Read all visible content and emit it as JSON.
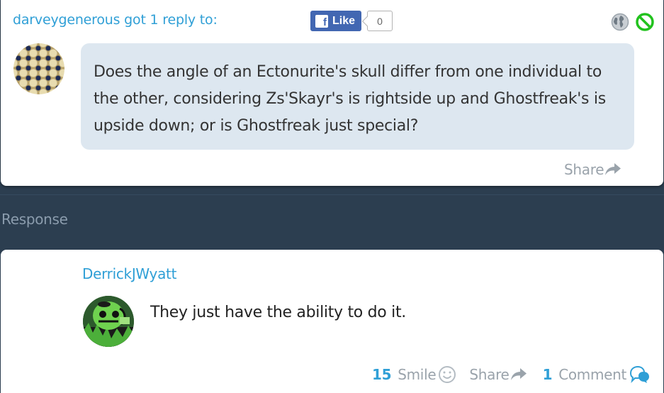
{
  "post": {
    "header": "darveygenerous got 1 reply to:",
    "fb_like_label": "Like",
    "fb_like_count": "0",
    "question": "Does the angle of an Ectonurite's skull differ from one individual to the other, considering Zs'Skayr's is rightside up and Ghostfreak's is upside down; or is Ghostfreak just special?",
    "share_label": "Share"
  },
  "section_label": "Response",
  "reply": {
    "username": "DerrickJWyatt",
    "text": "They just have the ability to do it.",
    "smile_count": "15",
    "smile_label": "Smile",
    "share_label": "Share",
    "comment_count": "1",
    "comment_label": "Comment"
  },
  "icons": {
    "globe": "globe-icon",
    "block": "block-icon",
    "share": "share-arrow-icon",
    "smile": "smile-icon",
    "comment": "comment-bubble-icon"
  },
  "colors": {
    "background": "#2c3e50",
    "accent": "#2f9fd6",
    "bubble": "#dde7f0",
    "facebook": "#4267b2",
    "block_green": "#22c21e"
  }
}
